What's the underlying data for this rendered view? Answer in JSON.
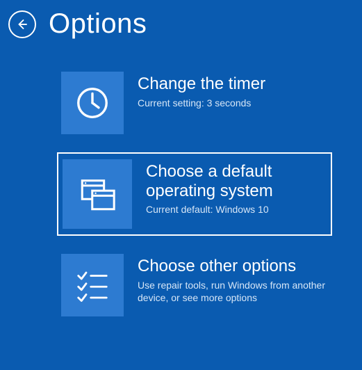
{
  "header": {
    "title": "Options"
  },
  "options": [
    {
      "title": "Change the timer",
      "subtitle": "Current setting: 3 seconds"
    },
    {
      "title": "Choose a default operating system",
      "subtitle": "Current default: Windows 10"
    },
    {
      "title": "Choose other options",
      "subtitle": "Use repair tools, run Windows from another device, or see more options"
    }
  ]
}
